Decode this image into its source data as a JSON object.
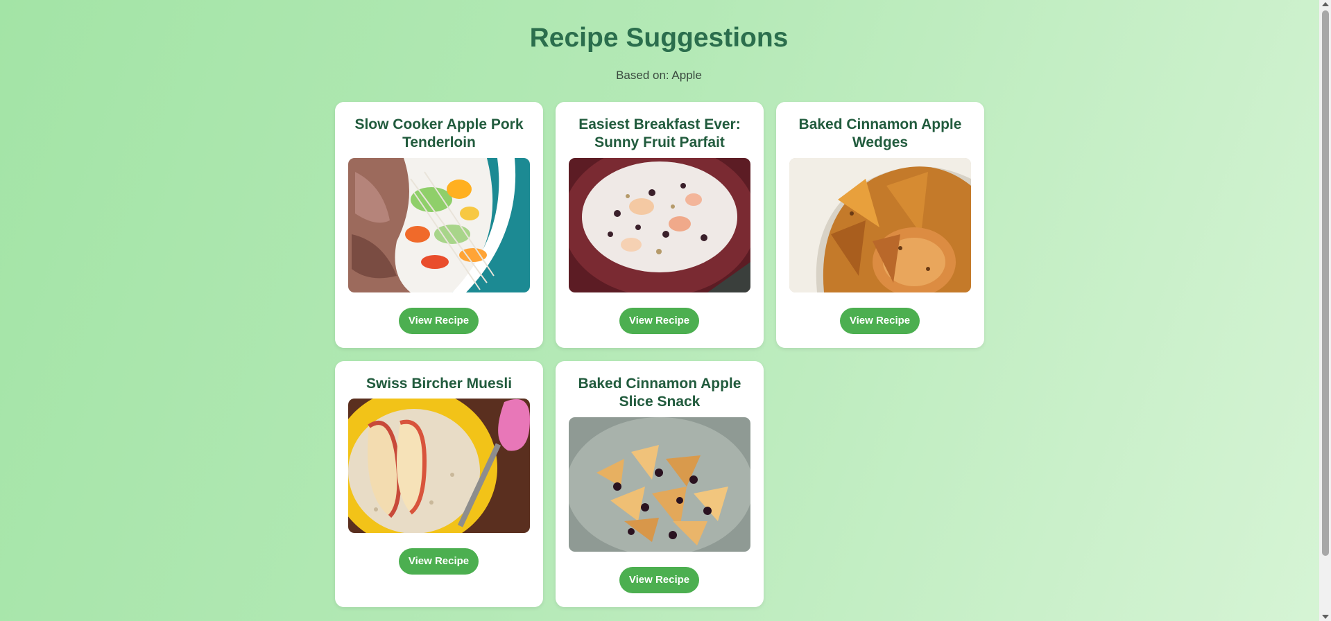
{
  "header": {
    "title": "Recipe Suggestions",
    "subtitle": "Based on: Apple"
  },
  "recipes": [
    {
      "title": "Slow Cooker Apple Pork Tenderloin",
      "button_label": "View Recipe",
      "image": "pork-tenderloin-salad-photo"
    },
    {
      "title": "Easiest Breakfast Ever: Sunny Fruit Parfait",
      "button_label": "View Recipe",
      "image": "yogurt-fruit-parfait-photo"
    },
    {
      "title": "Baked Cinnamon Apple Wedges",
      "button_label": "View Recipe",
      "image": "cinnamon-apple-wedges-photo"
    },
    {
      "title": "Swiss Bircher Muesli",
      "button_label": "View Recipe",
      "image": "bircher-muesli-photo"
    },
    {
      "title": "Baked Cinnamon Apple Slice Snack",
      "button_label": "View Recipe",
      "image": "cinnamon-apple-slices-photo"
    }
  ],
  "colors": {
    "accent": "#4caf50",
    "title": "#2b6e4d",
    "card_title": "#215b3d",
    "background_start": "#a3e4a6",
    "background_end": "#d6f4d5"
  }
}
